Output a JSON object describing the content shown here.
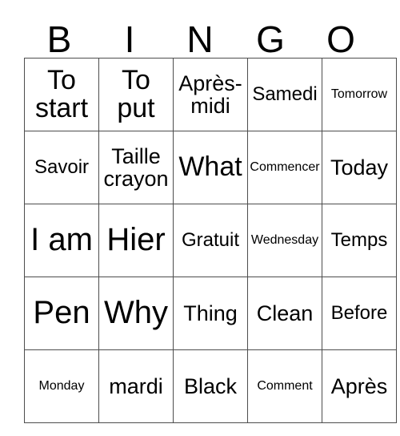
{
  "card": {
    "title_letters": [
      "B",
      "I",
      "N",
      "G",
      "O"
    ],
    "columns": 5,
    "rows": 5,
    "border_color": "#4d4d4d",
    "text_color": "#000000",
    "background_color": "#ffffff",
    "cells": [
      [
        {
          "text": "To start",
          "size": "lg"
        },
        {
          "text": "To put",
          "size": "lg"
        },
        {
          "text": "Après-midi",
          "size": "md"
        },
        {
          "text": "Samedi",
          "size": "sm"
        },
        {
          "text": "Tomorrow",
          "size": "xs"
        }
      ],
      [
        {
          "text": "Savoir",
          "size": "sm"
        },
        {
          "text": "Taille crayon",
          "size": "md"
        },
        {
          "text": "What",
          "size": "lg"
        },
        {
          "text": "Commencer",
          "size": "xs"
        },
        {
          "text": "Today",
          "size": "md"
        }
      ],
      [
        {
          "text": "I am",
          "size": "xl"
        },
        {
          "text": "Hier",
          "size": "xl"
        },
        {
          "text": "Gratuit",
          "size": "sm"
        },
        {
          "text": "Wednesday",
          "size": "xs"
        },
        {
          "text": "Temps",
          "size": "sm"
        }
      ],
      [
        {
          "text": "Pen",
          "size": "xl"
        },
        {
          "text": "Why",
          "size": "xl"
        },
        {
          "text": "Thing",
          "size": "md"
        },
        {
          "text": "Clean",
          "size": "md"
        },
        {
          "text": "Before",
          "size": "sm"
        }
      ],
      [
        {
          "text": "Monday",
          "size": "xs"
        },
        {
          "text": "mardi",
          "size": "md"
        },
        {
          "text": "Black",
          "size": "md"
        },
        {
          "text": "Comment",
          "size": "xs"
        },
        {
          "text": "Après",
          "size": "md"
        }
      ]
    ]
  }
}
